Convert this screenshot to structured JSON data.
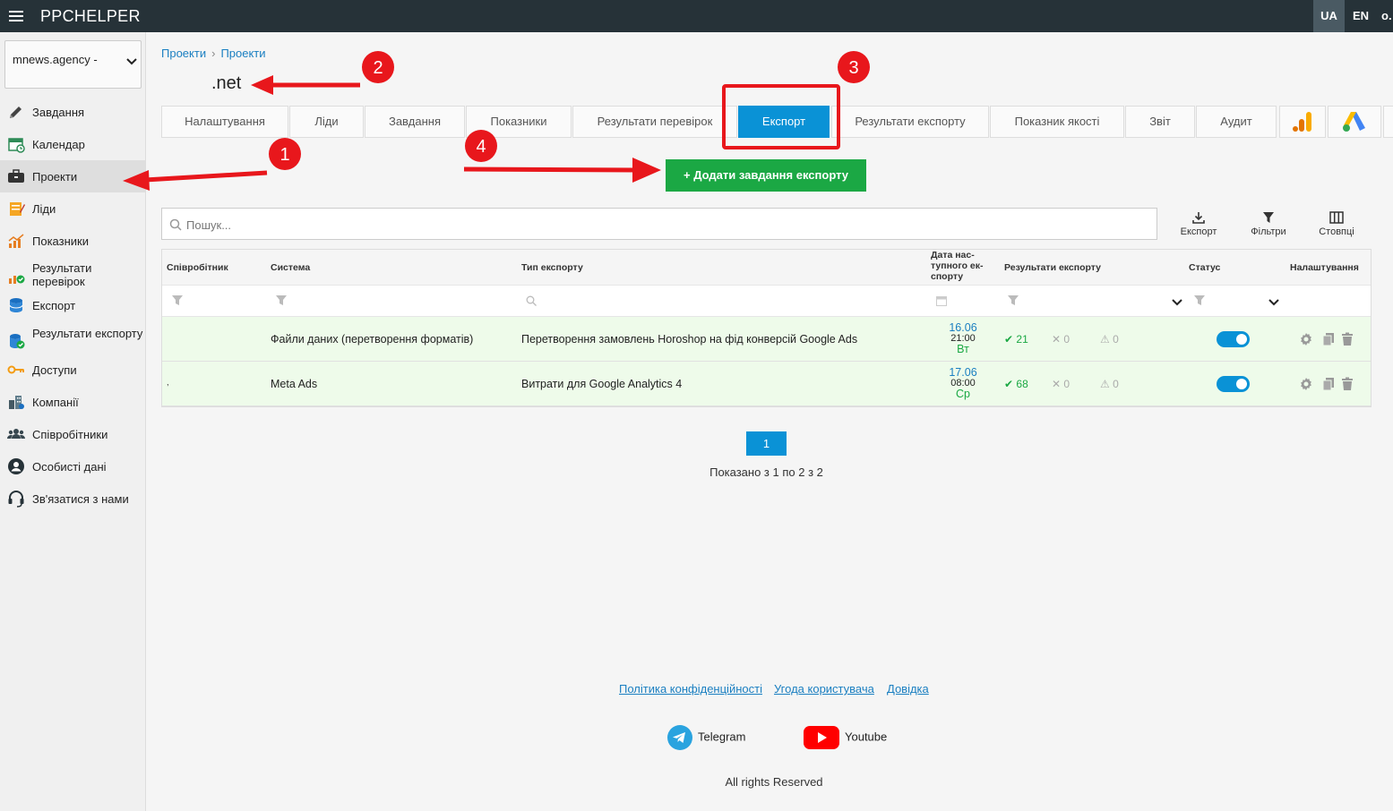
{
  "header": {
    "brand": "PPCHELPER",
    "langs": [
      "UA",
      "EN",
      "o."
    ]
  },
  "account": {
    "selected": "mnews.agency -"
  },
  "sidebar": {
    "items": [
      {
        "label": "Завдання",
        "icon": "pencil-icon"
      },
      {
        "label": "Календар",
        "icon": "calendar-icon"
      },
      {
        "label": "Проекти",
        "icon": "briefcase-icon",
        "active": true
      },
      {
        "label": "Ліди",
        "icon": "notepad-icon"
      },
      {
        "label": "Показники",
        "icon": "chart-icon"
      },
      {
        "label": "Результати перевірок",
        "icon": "check-chart-icon"
      },
      {
        "label": "Експорт",
        "icon": "database-icon"
      },
      {
        "label": "Результати експорту",
        "icon": "database-check-icon"
      },
      {
        "label": "Доступи",
        "icon": "key-icon"
      },
      {
        "label": "Компанії",
        "icon": "buildings-icon"
      },
      {
        "label": "Співробітники",
        "icon": "users-icon"
      },
      {
        "label": "Особисті дані",
        "icon": "user-circle-icon"
      },
      {
        "label": "Зв'язатися з нами",
        "icon": "headset-icon"
      }
    ]
  },
  "breadcrumb": [
    "Проекти",
    "Проекти"
  ],
  "page": {
    "title": ".net"
  },
  "tabs": [
    {
      "label": "Налаштування"
    },
    {
      "label": "Ліди"
    },
    {
      "label": "Завдання"
    },
    {
      "label": "Показники"
    },
    {
      "label": "Результати перевірок"
    },
    {
      "label": "Експорт",
      "selected": true
    },
    {
      "label": "Результати експорту"
    },
    {
      "label": "Показник якості"
    },
    {
      "label": "Звіт"
    },
    {
      "label": "Аудит"
    }
  ],
  "add_button": "+ Додати завдання експорту",
  "search": {
    "placeholder": "Пошук..."
  },
  "tools": {
    "export": "Експорт",
    "filters": "Фільтри",
    "columns": "Стовпці"
  },
  "table": {
    "columns": [
      "Співробітник",
      "Система",
      "Тип експорту",
      "Дата нас-тупного ек-спорту",
      "Результати експорту",
      "Статус",
      "Налаштування"
    ],
    "rows": [
      {
        "employee": "",
        "system": "Файли даних (перетворення форматів)",
        "type": "Перетворення замовлень Horoshop на фід конверсій Google Ads",
        "date": "16.06",
        "time": "21:00",
        "weekday": "Вт",
        "ok": "21",
        "err": "0",
        "warn": "0",
        "status": true
      },
      {
        "employee": ",",
        "system": "Meta Ads",
        "type": "Витрати для Google Analytics 4",
        "date": "17.06",
        "time": "08:00",
        "weekday": "Ср",
        "ok": "68",
        "err": "0",
        "warn": "0",
        "status": true
      }
    ]
  },
  "pagination": {
    "current": "1",
    "summary": "Показано з 1 по 2 з 2"
  },
  "footer": {
    "links": [
      "Політика конфіденційності",
      "Угода користувача",
      "Довідка"
    ],
    "telegram": "Telegram",
    "youtube": "Youtube",
    "copyright": "All rights Reserved"
  },
  "annotations": [
    "1",
    "2",
    "3",
    "4"
  ],
  "colors": {
    "topbar": "#263238",
    "accent": "#0a92d6",
    "success": "#1ba844",
    "annotation": "#e8171c"
  }
}
